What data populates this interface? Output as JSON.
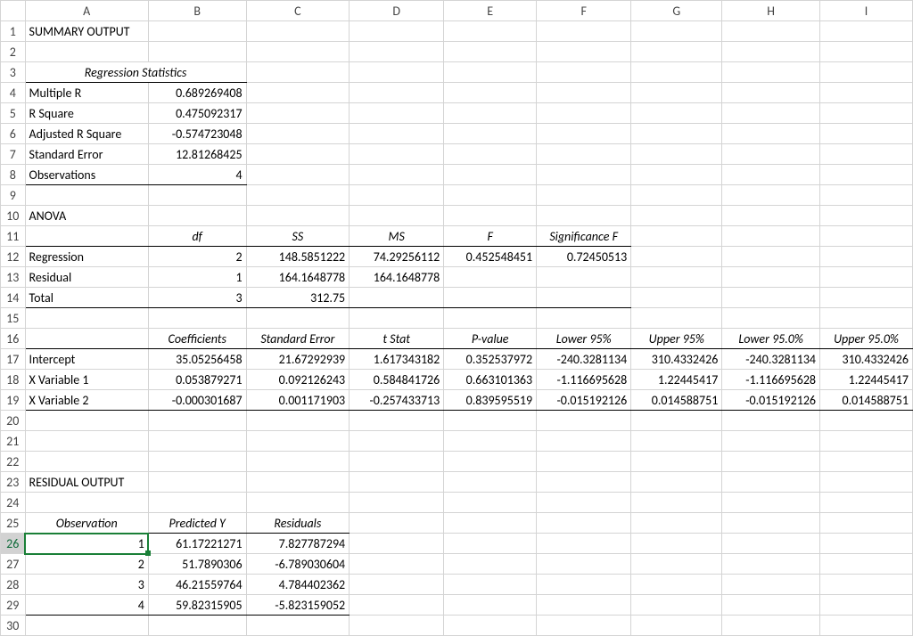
{
  "columns": [
    "A",
    "B",
    "C",
    "D",
    "E",
    "F",
    "G",
    "H",
    "I"
  ],
  "row_count": 30,
  "selected_row": 26,
  "summary_title": "SUMMARY OUTPUT",
  "reg_stats_title": "Regression Statistics",
  "reg_stats": {
    "multiple_r": {
      "label": "Multiple R",
      "value": "0.689269408"
    },
    "r_square": {
      "label": "R Square",
      "value": "0.475092317"
    },
    "adj_r_square": {
      "label": "Adjusted R Square",
      "value": "-0.574723048"
    },
    "std_error": {
      "label": "Standard Error",
      "value": "12.81268425"
    },
    "observations": {
      "label": "Observations",
      "value": "4"
    }
  },
  "anova_title": "ANOVA",
  "anova_headers": {
    "df": "df",
    "ss": "SS",
    "ms": "MS",
    "f": "F",
    "sigf": "Significance F"
  },
  "anova": {
    "regression": {
      "label": "Regression",
      "df": "2",
      "ss": "148.5851222",
      "ms": "74.29256112",
      "f": "0.452548451",
      "sigf": "0.72450513"
    },
    "residual": {
      "label": "Residual",
      "df": "1",
      "ss": "164.1648778",
      "ms": "164.1648778",
      "f": "",
      "sigf": ""
    },
    "total": {
      "label": "Total",
      "df": "3",
      "ss": "312.75",
      "ms": "",
      "f": "",
      "sigf": ""
    }
  },
  "coef_headers": {
    "coef": "Coefficients",
    "se": "Standard Error",
    "t": "t Stat",
    "p": "P-value",
    "lo95": "Lower 95%",
    "up95": "Upper 95%",
    "lo95b": "Lower 95.0%",
    "up95b": "Upper 95.0%"
  },
  "coef": {
    "intercept": {
      "label": "Intercept",
      "c": "35.05256458",
      "se": "21.67292939",
      "t": "1.617343182",
      "p": "0.352537972",
      "lo": "-240.3281134",
      "up": "310.4332426",
      "lo2": "-240.3281134",
      "up2": "310.4332426"
    },
    "x1": {
      "label": "X Variable 1",
      "c": "0.053879271",
      "se": "0.092126243",
      "t": "0.584841726",
      "p": "0.663101363",
      "lo": "-1.116695628",
      "up": "1.22445417",
      "lo2": "-1.116695628",
      "up2": "1.22445417"
    },
    "x2": {
      "label": "X Variable 2",
      "c": "-0.000301687",
      "se": "0.001171903",
      "t": "-0.257433713",
      "p": "0.839595519",
      "lo": "-0.015192126",
      "up": "0.014588751",
      "lo2": "-0.015192126",
      "up2": "0.014588751"
    }
  },
  "residual_title": "RESIDUAL OUTPUT",
  "res_headers": {
    "obs": "Observation",
    "pred": "Predicted Y",
    "resid": "Residuals"
  },
  "residuals": {
    "r1": {
      "obs": "1",
      "pred": "61.17221271",
      "resid": "7.827787294"
    },
    "r2": {
      "obs": "2",
      "pred": "51.7890306",
      "resid": "-6.789030604"
    },
    "r3": {
      "obs": "3",
      "pred": "46.21559764",
      "resid": "4.784402362"
    },
    "r4": {
      "obs": "4",
      "pred": "59.82315905",
      "resid": "-5.823159052"
    }
  }
}
